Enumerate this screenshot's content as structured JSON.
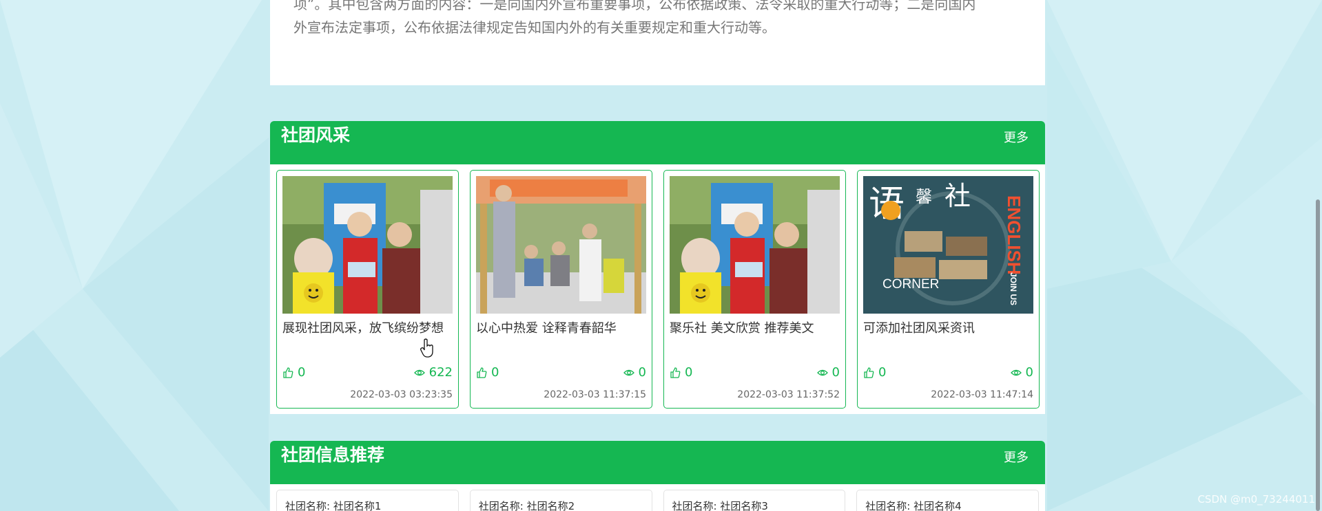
{
  "article": {
    "line1": "项”。其中包含两方面的内容：一是向国内外宣布重要事项，公布依据政策、法令采取的重大行动等；二是向国内",
    "line2": "外宣布法定事项，公布依据法律规定告知国内外的有关重要规定和重大行动等。"
  },
  "club_style": {
    "title": "社团风采",
    "more": "更多",
    "cards": [
      {
        "title": "展现社团风采，放飞缤纷梦想",
        "likes": "0",
        "views": "622",
        "time": "2022-03-03 03:23:35"
      },
      {
        "title": "以心中热爱 诠释青春韶华",
        "likes": "0",
        "views": "0",
        "time": "2022-03-03 11:37:15"
      },
      {
        "title": "聚乐社 美文欣赏 推荐美文",
        "likes": "0",
        "views": "0",
        "time": "2022-03-03 11:37:52"
      },
      {
        "title": "可添加社团风采资讯",
        "likes": "0",
        "views": "0",
        "time": "2022-03-03 11:47:14"
      }
    ],
    "poster": {
      "lang": "语",
      "sound": "馨",
      "club": "社",
      "word1": "ENGLISH",
      "word2": "CORNER",
      "word3": "JOIN US"
    }
  },
  "club_recommend": {
    "title": "社团信息推荐",
    "more": "更多",
    "cards": [
      {
        "label": "社团名称: 社团名称1"
      },
      {
        "label": "社团名称: 社团名称2"
      },
      {
        "label": "社团名称: 社团名称3"
      },
      {
        "label": "社团名称: 社团名称4"
      }
    ]
  },
  "watermark": "CSDN @m0_73244011",
  "icons": {
    "like": "thumbs-up-icon",
    "view": "eye-icon"
  },
  "colors": {
    "accent": "#15b752",
    "background": "#c9ebf1"
  }
}
